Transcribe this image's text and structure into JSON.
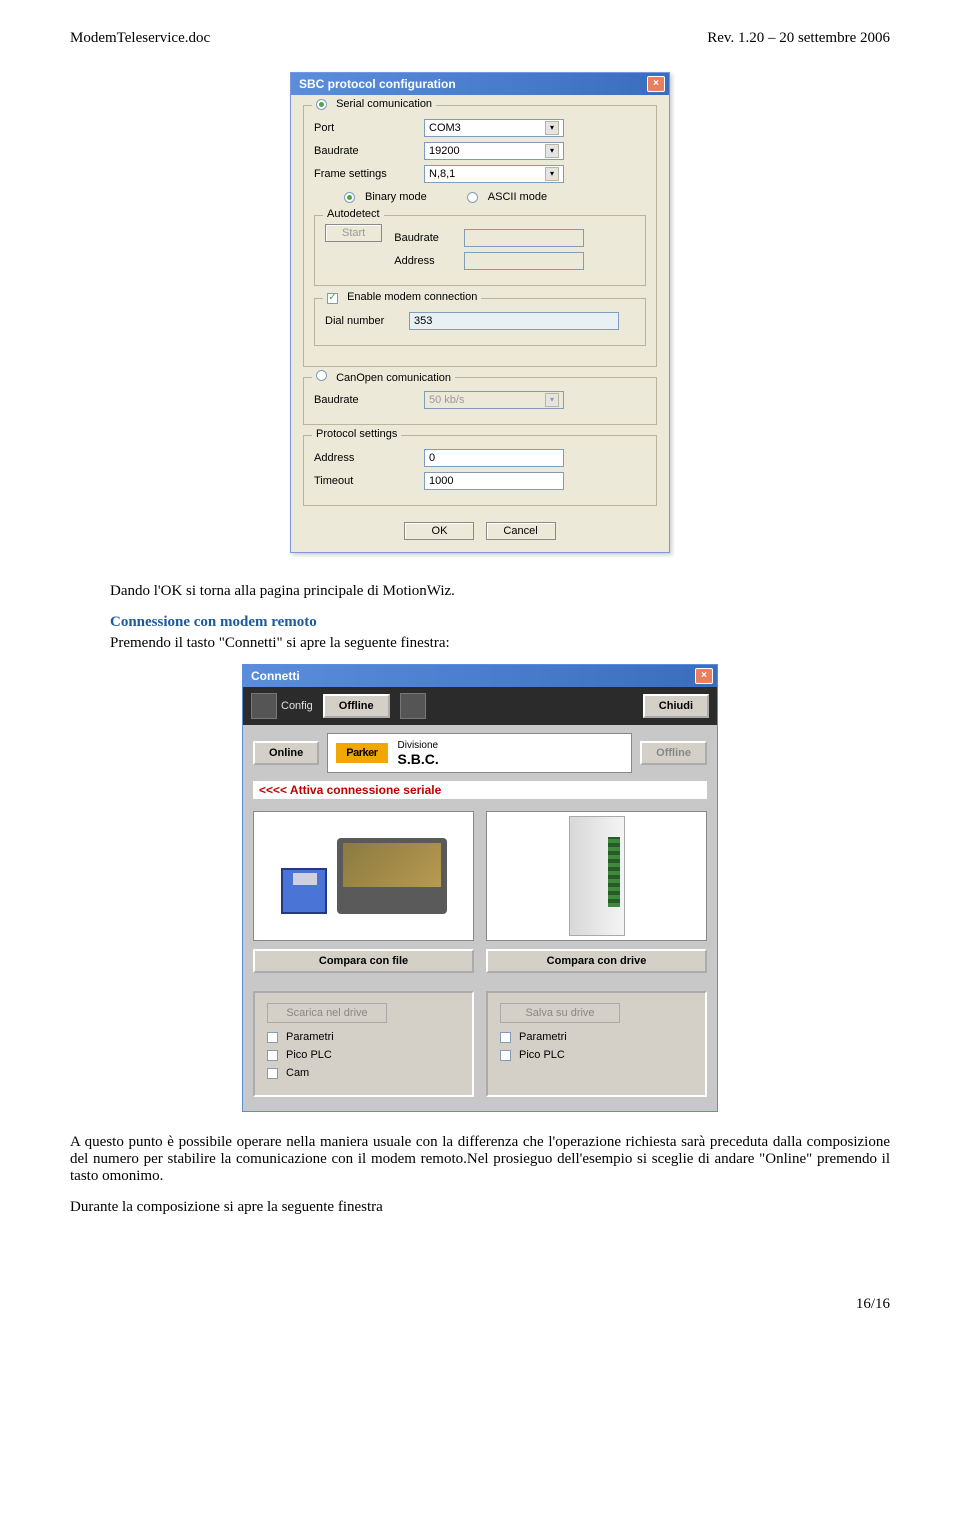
{
  "header": {
    "left": "ModemTeleservice.doc",
    "right": "Rev. 1.20 – 20 settembre 2006"
  },
  "dlg1": {
    "title": "SBC protocol configuration",
    "serial_group": "Serial comunication",
    "port_label": "Port",
    "port_value": "COM3",
    "baud_label": "Baudrate",
    "baud_value": "19200",
    "frame_label": "Frame settings",
    "frame_value": "N,8,1",
    "binary": "Binary mode",
    "ascii": "ASCII mode",
    "autodetect_group": "Autodetect",
    "start_btn": "Start",
    "ad_baud_label": "Baudrate",
    "ad_addr_label": "Address",
    "modem_group": "Enable modem connection",
    "dial_label": "Dial number",
    "dial_value": "353",
    "canopen_group": "CanOpen comunication",
    "can_baud_label": "Baudrate",
    "can_baud_value": "50 kb/s",
    "protocol_group": "Protocol settings",
    "addr_label": "Address",
    "addr_value": "0",
    "timeout_label": "Timeout",
    "timeout_value": "1000",
    "ok": "OK",
    "cancel": "Cancel"
  },
  "text": {
    "line1": "Dando l'OK si torna alla pagina principale di MotionWiz.",
    "section": "Connessione con modem remoto",
    "line2": "Premendo il tasto \"Connetti\" si apre la seguente finestra:"
  },
  "dlg2": {
    "title": "Connetti",
    "config": "Config",
    "offline_top": "Offline",
    "chiudi": "Chiudi",
    "online_btn": "Online",
    "parker": "Parker",
    "divisione": "Divisione",
    "sbc": "S.B.C.",
    "offline_btn": "Offline",
    "red": "<<<< Attiva connessione seriale",
    "compara_file": "Compara con file",
    "compara_drive": "Compara con drive",
    "scarica": "Scarica nel drive",
    "salva": "Salva su drive",
    "parametri": "Parametri",
    "picoplc": "Pico PLC",
    "cam": "Cam"
  },
  "para": {
    "p1_a": "A questo punto è possibile operare nella maniera usuale con la differenza che l'operazione richiesta sarà preceduta dalla composizione del numero per stabilire la comunicazione con il modem remoto.",
    "p1_b": "Nel prosieguo dell'esempio si sceglie di andare \"Online\" premendo il tasto omonimo.",
    "p2": "Durante la composizione si apre la seguente finestra"
  },
  "footer": "16/16"
}
